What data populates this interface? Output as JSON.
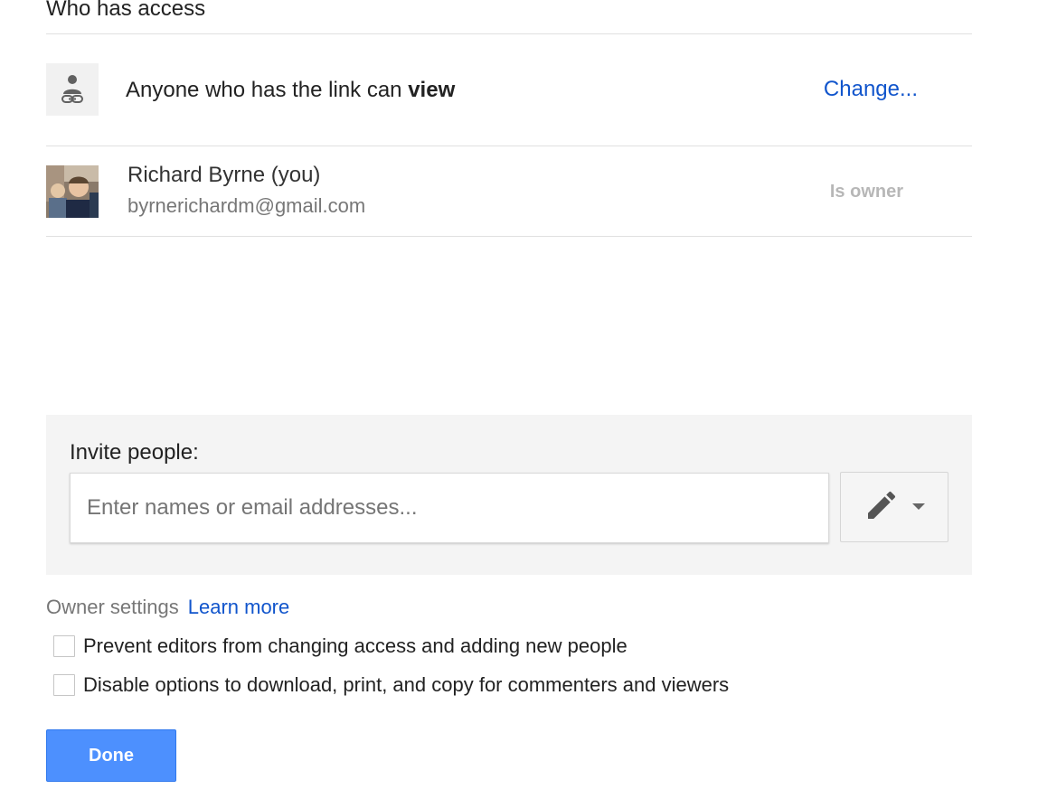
{
  "section": {
    "title": "Who has access"
  },
  "link_access": {
    "icon": "link-person-icon",
    "text_prefix": "Anyone who has the link can ",
    "text_permission": "view",
    "change_label": "Change..."
  },
  "owner": {
    "avatar": "avatar-photo",
    "name": "Richard Byrne (you)",
    "email": "byrnerichardm@gmail.com",
    "role_label": "Is owner"
  },
  "invite": {
    "label": "Invite people:",
    "placeholder": "Enter names or email addresses...",
    "value": "",
    "permission_icon": "pencil-icon",
    "dropdown_icon": "caret-down-icon"
  },
  "owner_settings": {
    "label": "Owner settings",
    "learn_more": "Learn more",
    "options": [
      {
        "label": "Prevent editors from changing access and adding new people",
        "checked": false
      },
      {
        "label": "Disable options to download, print, and copy for commenters and viewers",
        "checked": false
      }
    ]
  },
  "actions": {
    "done_label": "Done"
  },
  "colors": {
    "link_blue": "#1155cc",
    "primary_button": "#4d90fe",
    "panel_bg": "#f4f4f4"
  }
}
